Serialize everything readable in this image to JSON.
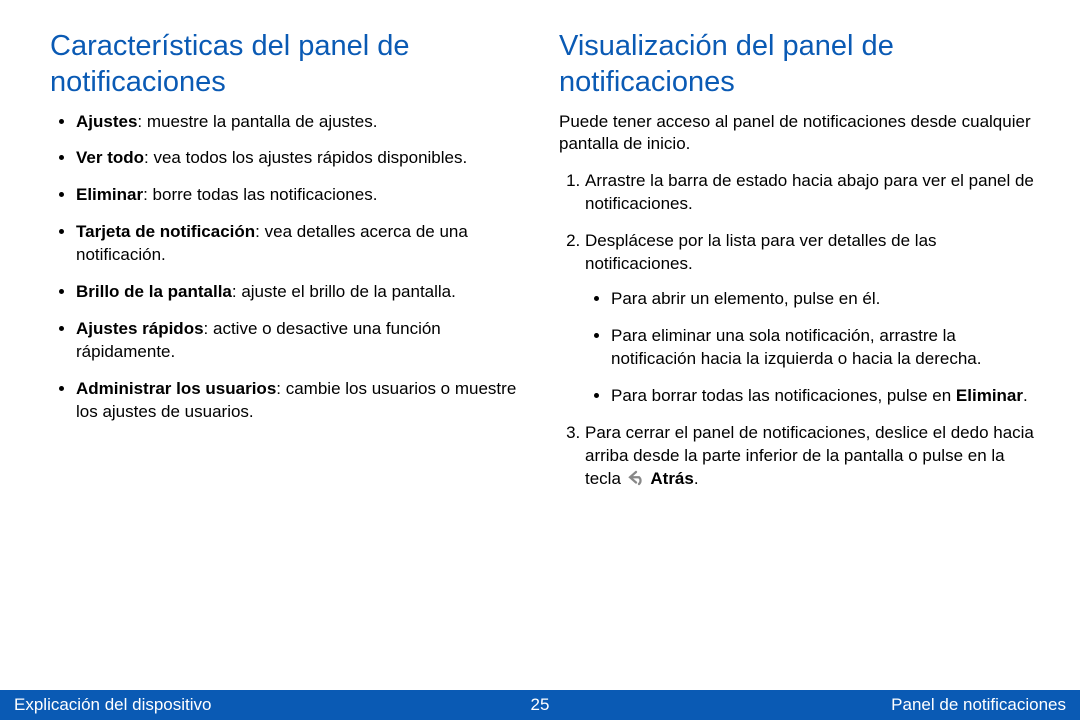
{
  "left": {
    "heading": "Características del panel de notificaciones",
    "items": [
      {
        "term": "Ajustes",
        "desc": ": muestre la pantalla de ajustes."
      },
      {
        "term": "Ver todo",
        "desc": ": vea todos los ajustes rápidos disponibles."
      },
      {
        "term": "Eliminar",
        "desc": ": borre todas las notificaciones."
      },
      {
        "term": "Tarjeta de notificación",
        "desc": ": vea detalles acerca de una notificación."
      },
      {
        "term": "Brillo de la pantalla",
        "desc": ": ajuste el brillo de la pantalla."
      },
      {
        "term": "Ajustes rápidos",
        "desc": ": active o desactive una función rápidamente."
      },
      {
        "term": "Administrar los usuarios",
        "desc": ": cambie los usuarios o muestre los ajustes de usuarios."
      }
    ]
  },
  "right": {
    "heading": "Visualización del panel de notificaciones",
    "lead": "Puede tener acceso al panel de notificaciones desde cualquier pantalla de inicio.",
    "step1": "Arrastre la barra de estado hacia abajo para ver el panel de notificaciones.",
    "step2": "Desplácese por la lista para ver detalles de las notificaciones.",
    "step2a": "Para abrir un elemento, pulse en él.",
    "step2b": "Para eliminar una sola notificación, arrastre la notificación hacia la izquierda o hacia la derecha.",
    "step2c_pre": "Para borrar todas las notificaciones, pulse en ",
    "step2c_bold": "Eliminar",
    "step2c_post": ".",
    "step3_pre": "Para cerrar el panel de notificaciones, deslice el dedo hacia arriba desde la parte inferior de la pantalla o pulse en la tecla ",
    "step3_bold": "Atrás",
    "step3_post": "."
  },
  "footer": {
    "left": "Explicación del dispositivo",
    "center": "25",
    "right": "Panel de notificaciones"
  }
}
